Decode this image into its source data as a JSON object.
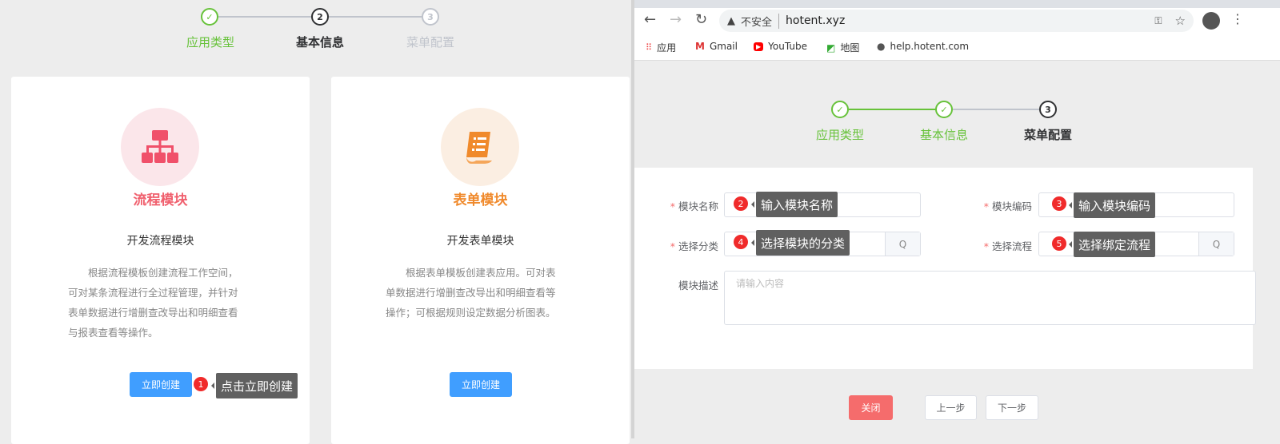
{
  "left_steps": [
    {
      "num": "1",
      "label": "应用类型",
      "state": "done"
    },
    {
      "num": "2",
      "label": "基本信息",
      "state": "active"
    },
    {
      "num": "3",
      "label": "菜单配置",
      "state": "pending"
    }
  ],
  "cards": [
    {
      "icon": "flowchart-icon",
      "title": "流程模块",
      "subtitle": "开发流程模块",
      "desc": [
        "　　根据流程模板创建流程工作空间，",
        "可对某条流程进行全过程管理，并针对",
        "表单数据进行增删查改导出和明细查看",
        "与报表查看等操作。"
      ],
      "button": "立即创建",
      "color": "#f0606e"
    },
    {
      "icon": "form-document-icon",
      "title": "表单模块",
      "subtitle": "开发表单模块",
      "desc": [
        "　　根据表单模板创建表应用。可对表",
        "单数据进行增删查改导出和明细查看等",
        "操作；可根据规则设定数据分析图表。"
      ],
      "button": "立即创建",
      "color": "#f08a2c"
    }
  ],
  "callouts": [
    {
      "num": "1",
      "text": "点击立即创建"
    },
    {
      "num": "2",
      "text": "输入模块名称"
    },
    {
      "num": "3",
      "text": "输入模块编码"
    },
    {
      "num": "4",
      "text": "选择模块的分类"
    },
    {
      "num": "5",
      "text": "选择绑定流程"
    }
  ],
  "browser": {
    "security": "不安全",
    "url": "hotent.xyz",
    "bookmarks": [
      "应用",
      "Gmail",
      "YouTube",
      "地图",
      "help.hotent.com"
    ]
  },
  "right_steps": [
    {
      "num": "✓",
      "label": "应用类型"
    },
    {
      "num": "✓",
      "label": "基本信息"
    },
    {
      "num": "3",
      "label": "菜单配置"
    }
  ],
  "form": {
    "name_label": "模块名称",
    "code_label": "模块编码",
    "category_label": "选择分类",
    "flow_label": "选择流程",
    "desc_label": "模块描述",
    "desc_placeholder": "请输入内容",
    "required_mark": "*",
    "search_icon": "Q"
  },
  "footer": {
    "close": "关闭",
    "prev": "上一步",
    "next": "下一步"
  },
  "colors": {
    "green": "#67c23a",
    "blue": "#409eff",
    "red": "#f56c6c"
  }
}
